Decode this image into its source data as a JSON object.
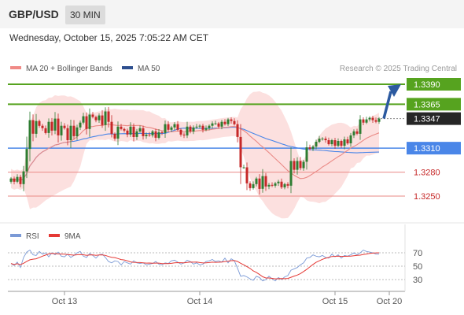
{
  "header": {
    "pair": "GBP/USD",
    "timeframe": "30 MIN"
  },
  "timestamp": "Wednesday, October 15, 2025 7:05:22 AM CET",
  "legend": [
    {
      "label": "MA 20 + Bollinger Bands",
      "color": "#f08a86"
    },
    {
      "label": "MA 50",
      "color": "#2e4f8f"
    }
  ],
  "credit": "Research © 2025 Trading Central",
  "colors": {
    "bullish": "#2e7d32",
    "bearish": "#c62828",
    "resistance": "#56a31f",
    "pivot": "#4a86e8",
    "support": "#ea8a86",
    "arrow": "#2c5aa0",
    "rsi": "#7b9ad6",
    "rsi_ma": "#e53935"
  },
  "chart_data": [
    {
      "type": "candlestick",
      "y_range": [
        1.3225,
        1.34
      ],
      "x_ticks": [
        "Oct 13",
        "Oct 14",
        "Oct 15",
        "Oct 20"
      ],
      "levels": [
        {
          "value": 1.339,
          "label": "1.3390",
          "kind": "resistance"
        },
        {
          "value": 1.3365,
          "label": "1.3365",
          "kind": "resistance"
        },
        {
          "value": 1.3347,
          "label": "1.3347",
          "kind": "last"
        },
        {
          "value": 1.331,
          "label": "1.3310",
          "kind": "pivot"
        },
        {
          "value": 1.328,
          "label": "1.3280",
          "kind": "support"
        },
        {
          "value": 1.325,
          "label": "1.3250",
          "kind": "support"
        }
      ],
      "forecast": {
        "from": 1.3347,
        "to": 1.339,
        "direction": "up"
      },
      "close": [
        1.3272,
        1.3268,
        1.3274,
        1.3265,
        1.3281,
        1.3309,
        1.3345,
        1.3328,
        1.3344,
        1.3338,
        1.3335,
        1.3329,
        1.3343,
        1.3332,
        1.3347,
        1.3326,
        1.3338,
        1.3335,
        1.332,
        1.3338,
        1.3325,
        1.3336,
        1.3342,
        1.335,
        1.3334,
        1.3352,
        1.3349,
        1.3345,
        1.3351,
        1.3339,
        1.3356,
        1.3343,
        1.3328,
        1.3322,
        1.3337,
        1.3334,
        1.3332,
        1.3327,
        1.3337,
        1.3324,
        1.3331,
        1.3335,
        1.3325,
        1.3327,
        1.3326,
        1.3331,
        1.3323,
        1.333,
        1.3329,
        1.334,
        1.3333,
        1.3336,
        1.334,
        1.3333,
        1.3327,
        1.3326,
        1.3337,
        1.3331,
        1.3336,
        1.3337,
        1.3338,
        1.3333,
        1.3335,
        1.3338,
        1.3341,
        1.3341,
        1.3337,
        1.3343,
        1.334,
        1.3346,
        1.3344,
        1.334,
        1.3324,
        1.3286,
        1.3286,
        1.3266,
        1.326,
        1.3265,
        1.3272,
        1.3259,
        1.3275,
        1.3262,
        1.3264,
        1.3263,
        1.3266,
        1.3268,
        1.3261,
        1.3265,
        1.3263,
        1.3294,
        1.3283,
        1.3294,
        1.3285,
        1.3293,
        1.3311,
        1.3309,
        1.3312,
        1.3318,
        1.3322,
        1.3322,
        1.332,
        1.3315,
        1.332,
        1.3313,
        1.3319,
        1.3313,
        1.3321,
        1.3316,
        1.3326,
        1.3331,
        1.3328,
        1.3346,
        1.3342,
        1.3346,
        1.3348,
        1.3345,
        1.3343,
        1.3347
      ],
      "rsi": [
        54,
        51,
        56,
        48,
        63,
        71,
        74,
        67,
        66,
        72,
        68,
        70,
        64,
        70,
        67,
        71,
        65,
        64,
        68,
        63,
        66,
        70,
        72,
        65,
        63,
        69,
        66,
        62,
        67,
        68,
        63,
        57,
        55,
        58,
        57,
        52,
        57,
        55,
        53,
        58,
        55,
        54,
        55,
        52,
        53,
        54,
        57,
        53,
        52,
        55,
        54,
        58,
        59,
        56,
        53,
        55,
        59,
        57,
        53,
        55,
        52,
        53,
        57,
        58,
        60,
        57,
        58,
        56,
        62,
        55,
        61,
        58,
        47,
        35,
        36,
        34,
        31,
        29,
        35,
        33,
        28,
        30,
        35,
        31,
        28,
        33,
        30,
        34,
        36,
        44,
        46,
        48,
        52,
        55,
        62,
        63,
        67,
        65,
        64,
        66,
        63,
        62,
        68,
        64,
        67,
        62,
        66,
        65,
        67,
        70,
        67,
        70,
        74,
        72,
        71,
        70,
        68,
        68
      ],
      "rsi_ticks": [
        "70",
        "50",
        "30"
      ],
      "rsi_legend": [
        {
          "label": "RSI",
          "color": "#7b9ad6"
        },
        {
          "label": "9MA",
          "color": "#e53935"
        }
      ]
    }
  ]
}
